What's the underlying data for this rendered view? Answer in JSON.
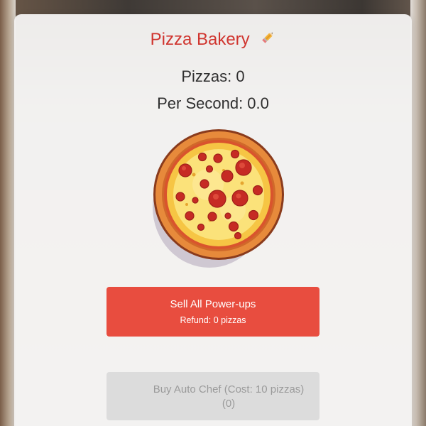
{
  "game": {
    "title": "Pizza Bakery",
    "pizzas_label": "Pizzas: 0",
    "rate_label": "Per Second: 0.0"
  },
  "pizza": {
    "icon": "pizza-icon"
  },
  "sell_button": {
    "label": "Sell All Power-ups",
    "refund": "Refund: 0 pizzas"
  },
  "buy_button": {
    "label": "Buy Auto Chef (Cost: 10 pizzas)",
    "count": "(0)",
    "disabled": true
  },
  "colors": {
    "title": "#d0352f",
    "sell_button": "#e84d3f",
    "buy_button_disabled": "#dcdcdc"
  }
}
